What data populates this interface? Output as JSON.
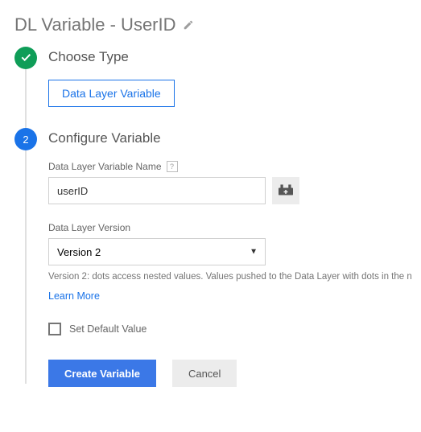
{
  "header": {
    "title": "DL Variable - UserID"
  },
  "steps": {
    "choose_type": {
      "title": "Choose Type",
      "selected_type": "Data Layer Variable"
    },
    "configure": {
      "number": "2",
      "title": "Configure Variable",
      "name_label": "Data Layer Variable Name",
      "name_value": "userID",
      "version_label": "Data Layer Version",
      "version_value": "Version 2",
      "version_hint": "Version 2: dots access nested values. Values pushed to the Data Layer with dots in the n",
      "learn_more": "Learn More",
      "set_default_label": "Set Default Value"
    }
  },
  "actions": {
    "create": "Create Variable",
    "cancel": "Cancel"
  }
}
